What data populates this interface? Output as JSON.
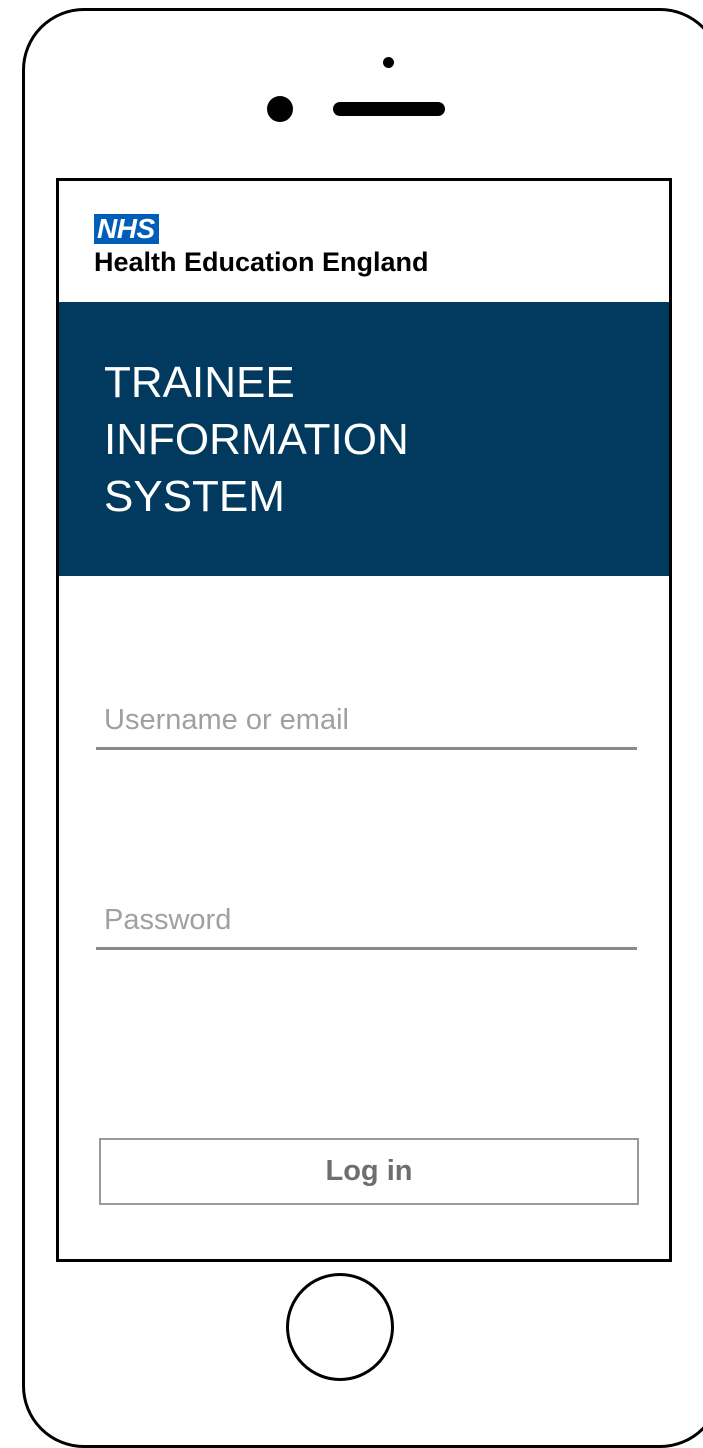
{
  "brand": {
    "logo_text": "NHS",
    "org_name": "Health Education England",
    "logo_color": "#005eb8"
  },
  "banner": {
    "title_lines": [
      "TRAINEE",
      "INFORMATION",
      "SYSTEM"
    ],
    "background_color": "#02395e"
  },
  "form": {
    "username": {
      "placeholder": "Username or email",
      "value": ""
    },
    "password": {
      "placeholder": "Password",
      "value": ""
    },
    "login_label": "Log in"
  },
  "device": {
    "icons": [
      "camera-icon",
      "sensor-icon",
      "speaker-icon",
      "home-button-icon"
    ]
  }
}
